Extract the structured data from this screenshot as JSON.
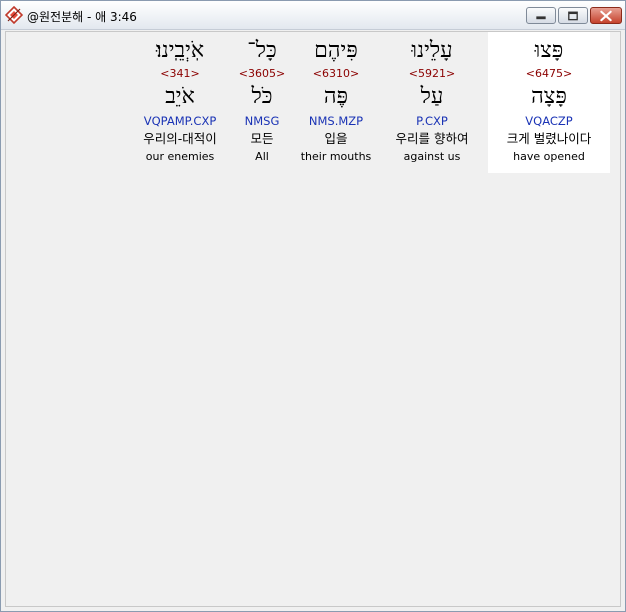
{
  "window": {
    "title": "@원전분해 - 애 3:46"
  },
  "columns": [
    {
      "hebrew": "אֹֽיְבֵֽינוּ׃",
      "strong": "<341>",
      "lemma": "אֹיֵב",
      "parsing": "VQPAMP.CXP",
      "korean": "우리의-대적이",
      "english": "our enemies"
    },
    {
      "hebrew": "כָּל־",
      "strong": "<3605>",
      "lemma": "כֹּל",
      "parsing": "NMSG",
      "korean": "모든",
      "english": "All"
    },
    {
      "hebrew": "פִּיהֶם",
      "strong": "<6310>",
      "lemma": "פֶּה",
      "parsing": "NMS.MZP",
      "korean": "입을",
      "english": "their mouths"
    },
    {
      "hebrew": "עָלֵינוּ",
      "strong": "<5921>",
      "lemma": "עַל",
      "parsing": "P.CXP",
      "korean": "우리를 향하여",
      "english": "against us"
    },
    {
      "hebrew": "פָּצוּ",
      "strong": "<6475>",
      "lemma": "פָּצָה",
      "parsing": "VQACZP",
      "korean": "크게 벌렸나이다",
      "english": "have opened"
    }
  ]
}
